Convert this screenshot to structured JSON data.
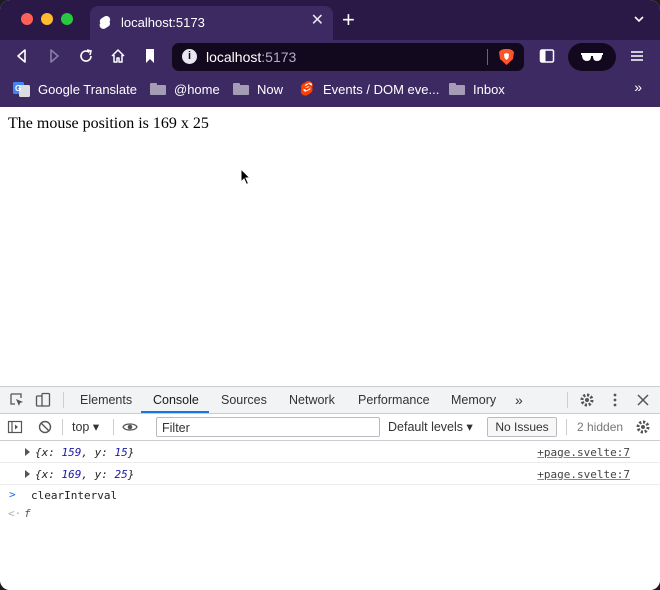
{
  "tab": {
    "title": "localhost:5173",
    "close": "✕",
    "new_tab": "+"
  },
  "address": {
    "host": "localhost",
    "port": ":5173",
    "info": "i"
  },
  "bookmarks": [
    {
      "label": "Google Translate",
      "icon": "google-translate-icon"
    },
    {
      "label": "@home",
      "icon": "folder-icon"
    },
    {
      "label": "Now",
      "icon": "folder-icon"
    },
    {
      "label": "Events / DOM eve...",
      "icon": "svelte-icon"
    },
    {
      "label": "Inbox",
      "icon": "folder-icon"
    }
  ],
  "bookmarks_more": "»",
  "page": {
    "text": "The mouse position is 169 x 25"
  },
  "devtools": {
    "tabs": [
      "Elements",
      "Console",
      "Sources",
      "Network",
      "Performance",
      "Memory"
    ],
    "more_tabs": "»",
    "active_tab": "Console",
    "context": "top ▾",
    "filter_placeholder": "Filter",
    "levels": "Default levels ▾",
    "issues": "No Issues",
    "hidden": "2 hidden"
  },
  "console": {
    "logs": [
      {
        "x_label": "{x: ",
        "x": "159",
        "y_label": ", y: ",
        "y": "15",
        "close": "}",
        "source": "+page.svelte:7"
      },
      {
        "x_label": "{x: ",
        "x": "169",
        "y_label": ", y: ",
        "y": "25",
        "close": "}",
        "source": "+page.svelte:7"
      }
    ],
    "prompt": ">",
    "command": "clearInterval",
    "return_arrow": "<·",
    "return_value": "f"
  },
  "colors": {
    "chrome_bg": "#3d2a63",
    "tabstrip_bg": "#2a1846",
    "urlbar_bg": "#12091f",
    "devtools_accent": "#1a73e8"
  }
}
